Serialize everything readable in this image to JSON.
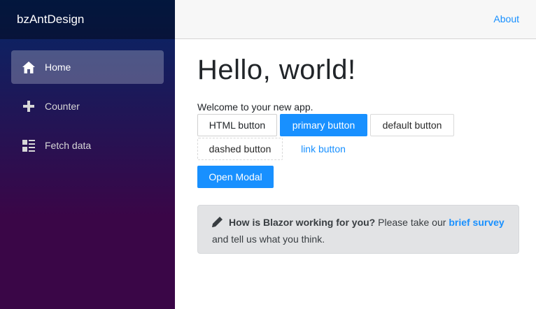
{
  "sidebar": {
    "brand": "bzAntDesign",
    "items": [
      {
        "label": "Home",
        "icon": "home-icon",
        "active": true
      },
      {
        "label": "Counter",
        "icon": "plus-icon",
        "active": false
      },
      {
        "label": "Fetch data",
        "icon": "list-rich-icon",
        "active": false
      }
    ]
  },
  "topbar": {
    "about": "About"
  },
  "main": {
    "title": "Hello, world!",
    "welcome": "Welcome to your new app.",
    "buttons": {
      "html": "HTML button",
      "primary": "primary button",
      "default": "default button",
      "dashed": "dashed button",
      "link": "link button",
      "open_modal": "Open Modal"
    },
    "survey": {
      "question": "How is Blazor working for you?",
      "prefix": "Please take our",
      "link": "brief survey",
      "suffix": "and tell us what you think."
    }
  },
  "colors": {
    "accent": "#1890ff",
    "sidebar_top": "#052767",
    "sidebar_bottom": "#3a0647",
    "alert_bg": "#e2e3e5"
  }
}
